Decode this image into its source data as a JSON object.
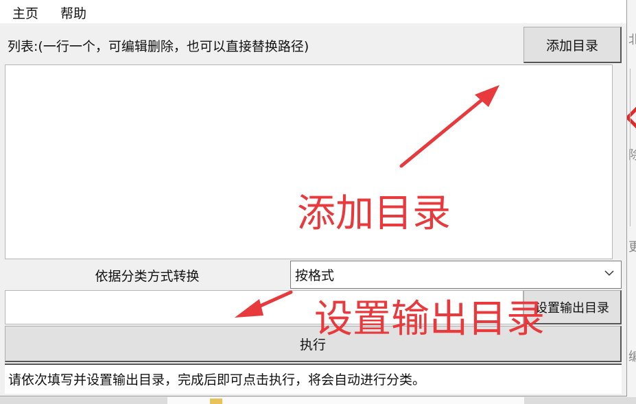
{
  "menu": {
    "home": "主页",
    "help": "帮助"
  },
  "list": {
    "label": "列表:(一行一个，可编辑删除，也可以直接替换路径)",
    "add_button": "添加目录"
  },
  "mode": {
    "label": "依据分类方式转换",
    "selected": "按格式"
  },
  "output": {
    "value": "",
    "button": "设置输出目录"
  },
  "run_button": "执行",
  "status_text": "请依次填写并设置输出目录，完成后即可点击执行，将会自动进行分类。",
  "annotations": {
    "add": "添加目录",
    "output": "设置输出目录"
  },
  "background_fragments": [
    "北",
    "除",
    "更",
    "编"
  ],
  "colors": {
    "annotation": "#e8393c",
    "window": "#f0f0f0",
    "field": "#ffffff"
  }
}
